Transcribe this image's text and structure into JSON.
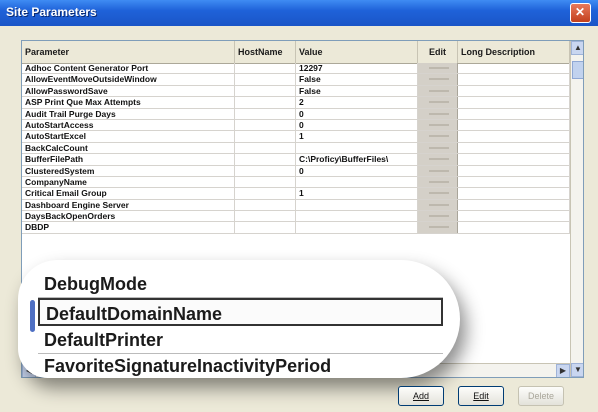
{
  "window": {
    "title": "Site Parameters"
  },
  "table": {
    "columns": [
      "Parameter",
      "HostName",
      "Value",
      "Edit",
      "Long Description"
    ],
    "rows": [
      {
        "parameter": "Adhoc Content Generator Port",
        "host": "",
        "value": "12297"
      },
      {
        "parameter": "AllowEventMoveOutsideWindow",
        "host": "",
        "value": "False"
      },
      {
        "parameter": "AllowPasswordSave",
        "host": "",
        "value": "False"
      },
      {
        "parameter": "ASP Print Que Max Attempts",
        "host": "",
        "value": "2"
      },
      {
        "parameter": "Audit Trail Purge Days",
        "host": "",
        "value": "0"
      },
      {
        "parameter": "AutoStartAccess",
        "host": "",
        "value": "0"
      },
      {
        "parameter": "AutoStartExcel",
        "host": "",
        "value": "1"
      },
      {
        "parameter": "BackCalcCount",
        "host": "",
        "value": ""
      },
      {
        "parameter": "BufferFilePath",
        "host": "",
        "value": "C:\\Proficy\\BufferFiles\\"
      },
      {
        "parameter": "ClusteredSystem",
        "host": "",
        "value": "0"
      },
      {
        "parameter": "CompanyName",
        "host": "",
        "value": ""
      },
      {
        "parameter": "Critical Email Group",
        "host": "",
        "value": "1"
      },
      {
        "parameter": "Dashboard Engine Server",
        "host": "",
        "value": ""
      },
      {
        "parameter": "DaysBackOpenOrders",
        "host": "",
        "value": ""
      },
      {
        "parameter": "DBDP",
        "host": "",
        "value": ""
      }
    ]
  },
  "magnifier": {
    "rows": [
      "DebugMode",
      "DefaultDomainName",
      "DefaultPrinter",
      "FavoriteSignatureInactivityPeriod"
    ],
    "selected_index": 1
  },
  "buttons": {
    "add": "Add",
    "edit": "Edit",
    "delete": "Delete"
  }
}
